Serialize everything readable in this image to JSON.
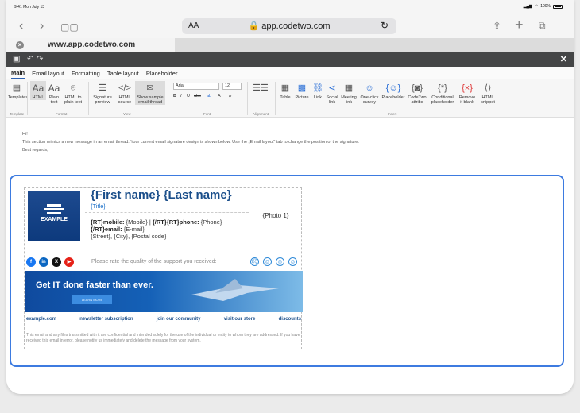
{
  "status": {
    "time": "9:41 Mon July 13",
    "battery": "100%"
  },
  "browser": {
    "aa": "AA",
    "url": "app.codetwo.com",
    "tab_title": "www.app.codetwo.com"
  },
  "menu": {
    "tabs": [
      "Main",
      "Email layout",
      "Formatting",
      "Table layout",
      "Placeholder"
    ]
  },
  "ribbon": {
    "templates": "Templates",
    "html": "HTML",
    "plain_text": "Plain text",
    "html_to_plain": "HTML to plain text",
    "signature_preview": "Signature preview",
    "html_source": "HTML source",
    "show_sample": "Show sample email thread",
    "font_name": "Arial",
    "font_size": "12",
    "table": "Table",
    "picture": "Picture",
    "link": "Link",
    "social_link": "Social link",
    "meeting_link": "Meeting link",
    "survey": "One-click survey",
    "placeholder": "Placeholder",
    "codetwo_attribs": "CodeTwo attribs",
    "conditional": "Conditional placeholder",
    "remove_if_blank": "Remove if blank",
    "html_snippet": "HTML snippet",
    "groups": {
      "template": "Template",
      "format": "Format",
      "view": "View",
      "font": "Font",
      "alignment": "Alignment",
      "insert": "Insert"
    }
  },
  "preview": {
    "greeting": "Hi!",
    "body": "This section mimics a new message in an email thread. Your current email signature design is shown below. Use the „Email layout\" tab to change the position of the signature.",
    "closing": "Best regards,"
  },
  "signature": {
    "logo_text": "EXAMPLE",
    "name": "{First name} {Last name}",
    "title": "{Title}",
    "mobile_label": "{RT}mobile:",
    "mobile_value": "{Mobile}",
    "sep": "|",
    "phone_label": "{/RT}{RT}phone:",
    "phone_value": "{Phone}",
    "email_label": "{/RT}email:",
    "email_value": "{E-mail}",
    "address": "{Street}, {City}, {Postal code}",
    "photo": "{Photo 1}",
    "rate": "Please rate the quality of the support you received:",
    "banner_text": "Get IT done faster than ever.",
    "banner_btn": "LEARN MORE",
    "links": [
      "example.com",
      "newsletter subscription",
      "join our community",
      "visit our store",
      "discounts"
    ],
    "disclaimer": "This email and any files transmitted with it are confidential and intended solely for the use of the individual or entity to whom they are addressed. If you have received this email in error, please notify us immediately and delete the message from your system."
  }
}
